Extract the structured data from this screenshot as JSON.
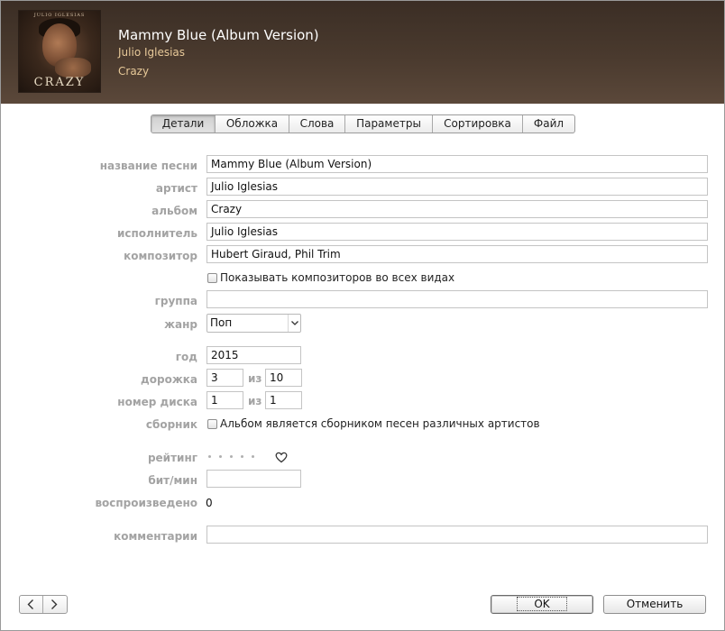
{
  "header": {
    "title": "Mammy Blue (Album Version)",
    "artist": "Julio Iglesias",
    "album": "Crazy",
    "art_top_text": "JULIO IGLESIAS",
    "art_title_text": "CRAZY"
  },
  "tabs": [
    {
      "label": "Детали",
      "active": true
    },
    {
      "label": "Обложка",
      "active": false
    },
    {
      "label": "Слова",
      "active": false
    },
    {
      "label": "Параметры",
      "active": false
    },
    {
      "label": "Сортировка",
      "active": false
    },
    {
      "label": "Файл",
      "active": false
    }
  ],
  "form": {
    "song_name": {
      "label": "название песни",
      "value": "Mammy Blue (Album Version)"
    },
    "artist": {
      "label": "артист",
      "value": "Julio Iglesias"
    },
    "album": {
      "label": "альбом",
      "value": "Crazy"
    },
    "album_artist": {
      "label": "исполнитель",
      "value": "Julio Iglesias"
    },
    "composer": {
      "label": "композитор",
      "value": "Hubert Giraud, Phil Trim"
    },
    "show_composers": {
      "label": "Показывать композиторов во всех видах",
      "checked": false
    },
    "grouping": {
      "label": "группа",
      "value": ""
    },
    "genre": {
      "label": "жанр",
      "value": "Поп"
    },
    "year": {
      "label": "год",
      "value": "2015"
    },
    "track": {
      "label": "дорожка",
      "value": "3",
      "of_label": "из",
      "total": "10"
    },
    "disc": {
      "label": "номер диска",
      "value": "1",
      "of_label": "из",
      "total": "1"
    },
    "compilation": {
      "label": "сборник",
      "checkbox_label": "Альбом является сборником песен различных артистов",
      "checked": false
    },
    "rating": {
      "label": "рейтинг",
      "stars": 0,
      "loved": false
    },
    "bpm": {
      "label": "бит/мин",
      "value": ""
    },
    "plays": {
      "label": "воспроизведено",
      "value": "0"
    },
    "comments": {
      "label": "комментарии",
      "value": ""
    }
  },
  "footer": {
    "ok_label": "OK",
    "cancel_label": "Отменить"
  },
  "colors": {
    "header_bg": "#4a3a2e",
    "title": "#ffffff",
    "subtitle": "#e7c999",
    "label": "#a3a3a3"
  }
}
